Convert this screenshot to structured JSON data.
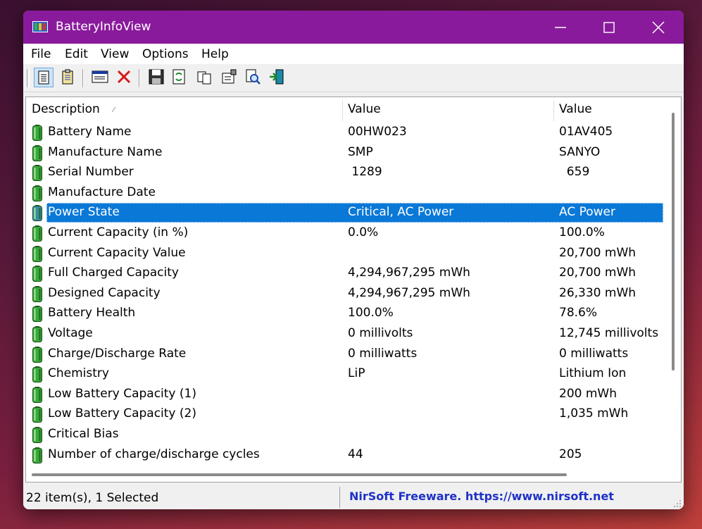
{
  "window": {
    "title": "BatteryInfoView",
    "title_bar_color": "#8a1a9c",
    "controls": [
      "minimize-icon",
      "maximize-icon",
      "close-icon"
    ]
  },
  "menu": [
    "File",
    "Edit",
    "View",
    "Options",
    "Help"
  ],
  "toolbar": {
    "buttons": [
      "battery-information-icon",
      "battery-log-icon",
      "properties-window-icon",
      "delete-icon",
      "save-icon",
      "refresh-icon",
      "copy-icon",
      "properties-icon",
      "find-icon",
      "exit-icon"
    ]
  },
  "list": {
    "columns": [
      "Description",
      "Value",
      "Value"
    ],
    "rows": [
      {
        "description": "Battery Name",
        "value1": "00HW023",
        "value2": "01AV405"
      },
      {
        "description": "Manufacture Name",
        "value1": "SMP",
        "value2": "SANYO"
      },
      {
        "description": "Serial Number",
        "value1": " 1289",
        "value2": "  659"
      },
      {
        "description": "Manufacture Date",
        "value1": "",
        "value2": ""
      },
      {
        "description": "Power State",
        "value1": "Critical, AC Power",
        "value2": "AC Power",
        "selected": true
      },
      {
        "description": "Current Capacity (in %)",
        "value1": "0.0%",
        "value2": "100.0%"
      },
      {
        "description": "Current Capacity Value",
        "value1": "",
        "value2": "20,700 mWh"
      },
      {
        "description": "Full Charged Capacity",
        "value1": "4,294,967,295 mWh",
        "value2": "20,700 mWh"
      },
      {
        "description": "Designed Capacity",
        "value1": "4,294,967,295 mWh",
        "value2": "26,330 mWh"
      },
      {
        "description": "Battery Health",
        "value1": "100.0%",
        "value2": "78.6%"
      },
      {
        "description": "Voltage",
        "value1": "0 millivolts",
        "value2": "12,745 millivolts"
      },
      {
        "description": "Charge/Discharge Rate",
        "value1": "0 milliwatts",
        "value2": "0 milliwatts"
      },
      {
        "description": "Chemistry",
        "value1": "LiP",
        "value2": "Lithium Ion"
      },
      {
        "description": "Low Battery Capacity (1)",
        "value1": "",
        "value2": "200 mWh"
      },
      {
        "description": "Low Battery Capacity (2)",
        "value1": "",
        "value2": "1,035 mWh"
      },
      {
        "description": "Critical Bias",
        "value1": "",
        "value2": ""
      },
      {
        "description": "Number of charge/discharge cycles",
        "value1": "44",
        "value2": "205"
      }
    ],
    "selection_color": "#0a78d7"
  },
  "status": {
    "left": "22 item(s), 1 Selected",
    "right": "NirSoft Freeware. https://www.nirsoft.net",
    "link_color": "#1e32c8"
  }
}
